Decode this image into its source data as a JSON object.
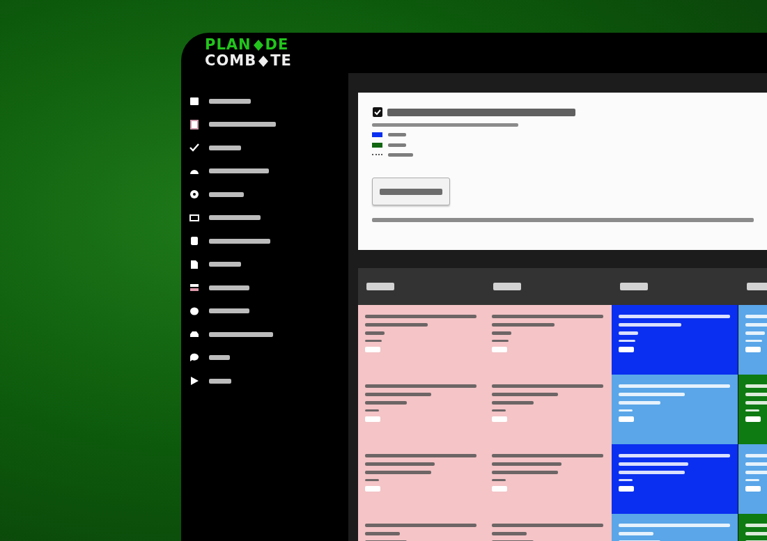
{
  "logo": {
    "top": [
      "PLAN",
      "DE"
    ],
    "bottom": [
      "COMB",
      "TE"
    ]
  },
  "sidebar": {
    "items": [
      {
        "kind": "calendar"
      },
      {
        "kind": "book"
      },
      {
        "kind": "check"
      },
      {
        "kind": "gauge"
      },
      {
        "kind": "eye"
      },
      {
        "kind": "card"
      },
      {
        "kind": "notes"
      },
      {
        "kind": "file"
      },
      {
        "kind": "stack"
      },
      {
        "kind": "brain"
      },
      {
        "kind": "car"
      },
      {
        "kind": "chat"
      },
      {
        "kind": "play"
      }
    ]
  },
  "card": {
    "legend": [
      {
        "kind": "swatch",
        "color": "#0a2ff0"
      },
      {
        "kind": "swatch",
        "color": "#116611"
      },
      {
        "kind": "dots"
      }
    ]
  },
  "table": {
    "rows": [
      {
        "cells": [
          {
            "color": "#f4c4c6"
          },
          {
            "color": "#f4c4c6"
          },
          {
            "color": "#0a2ff0"
          },
          {
            "color": "#5aa6e8"
          }
        ]
      },
      {
        "cells": [
          {
            "color": "#f4c4c6"
          },
          {
            "color": "#f4c4c6"
          },
          {
            "color": "#5aa6e8"
          },
          {
            "color": "#0e7a12"
          }
        ]
      },
      {
        "cells": [
          {
            "color": "#f4c4c6"
          },
          {
            "color": "#f4c4c6"
          },
          {
            "color": "#0a2ff0"
          },
          {
            "color": "#5aa6e8"
          }
        ]
      },
      {
        "cells": [
          {
            "color": "#f4c4c6"
          },
          {
            "color": "#f4c4c6"
          },
          {
            "color": "#5aa6e8"
          },
          {
            "color": "#0e7a12"
          }
        ]
      }
    ]
  }
}
